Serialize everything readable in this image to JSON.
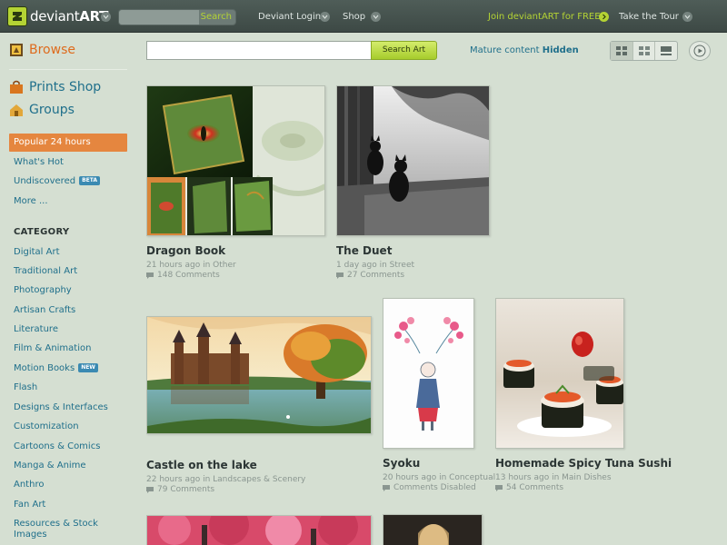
{
  "topbar": {
    "logo_icon": "deviantart-logo-icon",
    "brand_light": "deviant",
    "brand_bold": "ART",
    "search_label": "Search",
    "login_label": "Deviant Login",
    "shop_label": "Shop",
    "join_label": "Join deviantART for FREE",
    "tour_label": "Take the Tour"
  },
  "sidebar": {
    "browse": "Browse",
    "prints_shop": "Prints Shop",
    "groups": "Groups",
    "sort_items": [
      {
        "label": "Popular 24 hours",
        "active": true
      },
      {
        "label": "What's Hot"
      },
      {
        "label": "Undiscovered",
        "badge": "BETA"
      },
      {
        "label": "More ..."
      }
    ],
    "category_heading": "CATEGORY",
    "categories": [
      {
        "label": "Digital Art"
      },
      {
        "label": "Traditional Art"
      },
      {
        "label": "Photography"
      },
      {
        "label": "Artisan Crafts"
      },
      {
        "label": "Literature"
      },
      {
        "label": "Film & Animation"
      },
      {
        "label": "Motion Books",
        "badge": "NEW"
      },
      {
        "label": "Flash"
      },
      {
        "label": "Designs & Interfaces"
      },
      {
        "label": "Customization"
      },
      {
        "label": "Cartoons & Comics"
      },
      {
        "label": "Manga & Anime"
      },
      {
        "label": "Anthro"
      },
      {
        "label": "Fan Art"
      },
      {
        "label": "Resources & Stock Images"
      }
    ]
  },
  "main": {
    "search_placeholder": "",
    "search_button": "Search Art",
    "mature_label": "Mature content",
    "mature_value": "Hidden",
    "view_modes": [
      "grid-large-icon",
      "grid-small-icon",
      "slideshow-strip-icon"
    ],
    "play_icon": "play-icon"
  },
  "artworks": [
    {
      "title": "Dragon Book",
      "meta": "21 hours ago in Other",
      "comments": "148 Comments"
    },
    {
      "title": "The Duet",
      "meta": "1 day ago in Street",
      "comments": "27 Comments"
    },
    {
      "title": "Castle on the lake",
      "meta": "22 hours ago in Landscapes & Scenery",
      "comments": "79 Comments"
    },
    {
      "title": "Syoku",
      "meta": "20 hours ago in Conceptual",
      "comments": "Comments Disabled"
    },
    {
      "title": "Homemade Spicy Tuna Sushi",
      "meta": "13 hours ago in Main Dishes",
      "comments": "54 Comments"
    }
  ],
  "colors": {
    "page_bg": "#d5dfd2",
    "topbar_bg": "#46534f",
    "accent_green": "#b4d334",
    "link_blue": "#1f6f8b",
    "browse_orange": "#de6b1d",
    "active_orange": "#e5863f"
  }
}
